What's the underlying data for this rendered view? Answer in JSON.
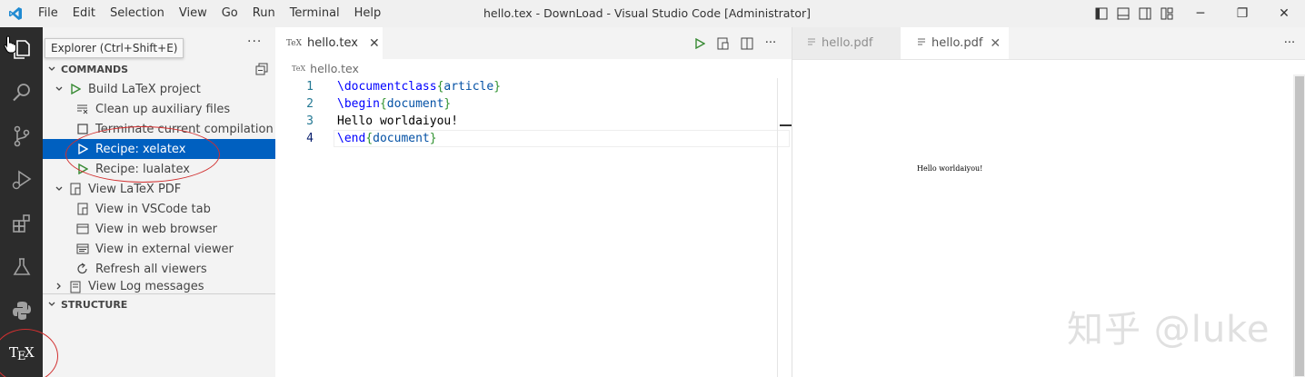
{
  "window": {
    "title": "hello.tex - DownLoad - Visual Studio Code [Administrator]",
    "menu": [
      "File",
      "Edit",
      "Selection",
      "View",
      "Go",
      "Run",
      "Terminal",
      "Help"
    ],
    "controls": {
      "minimize": "─",
      "maximize": "❐",
      "close": "✕"
    }
  },
  "activity_bar": {
    "items": [
      "explorer-icon",
      "search-icon",
      "source-control-icon",
      "run-debug-icon",
      "extensions-icon",
      "testing-icon",
      "python-icon",
      "tex-icon"
    ]
  },
  "sidebar": {
    "tooltip": "Explorer (Ctrl+Shift+E)",
    "more": "···",
    "commands_header": "COMMANDS",
    "structure_header": "STRUCTURE",
    "items": [
      {
        "label": "Build LaTeX project",
        "icon": "play-icon"
      },
      {
        "label": "Clean up auxiliary files",
        "icon": "clear-all-icon"
      },
      {
        "label": "Terminate current compilation",
        "icon": "stop-icon"
      },
      {
        "label": "Recipe: xelatex",
        "icon": "play-icon"
      },
      {
        "label": "Recipe: lualatex",
        "icon": "play-icon"
      },
      {
        "label": "View LaTeX PDF",
        "icon": "preview-icon"
      },
      {
        "label": "View in VSCode tab",
        "icon": "preview-icon"
      },
      {
        "label": "View in web browser",
        "icon": "browser-icon"
      },
      {
        "label": "View in external viewer",
        "icon": "external-viewer-icon"
      },
      {
        "label": "Refresh all viewers",
        "icon": "refresh-icon"
      },
      {
        "label": "View Log messages",
        "icon": "log-icon"
      }
    ]
  },
  "editor1": {
    "tab": {
      "label": "hello.tex",
      "icon_text": "TeX",
      "close": "✕"
    },
    "breadcrumb": "hello.tex",
    "lines": [
      {
        "n": "1",
        "a": "\\documentclass",
        "b": "{",
        "c": "article",
        "d": "}"
      },
      {
        "n": "2",
        "a": "\\begin",
        "b": "{",
        "c": "document",
        "d": "}"
      },
      {
        "n": "3",
        "text": "Hello worldaiyou!"
      },
      {
        "n": "4",
        "a": "\\end",
        "b": "{",
        "c": "document",
        "d": "}"
      }
    ],
    "more": "···"
  },
  "editor2": {
    "tabs": [
      {
        "label": "hello.pdf"
      },
      {
        "label": "hello.pdf",
        "close": "✕"
      }
    ],
    "pdf_text": "Hello worldaiyou!",
    "more": "···"
  },
  "watermark": "知乎 @luke"
}
